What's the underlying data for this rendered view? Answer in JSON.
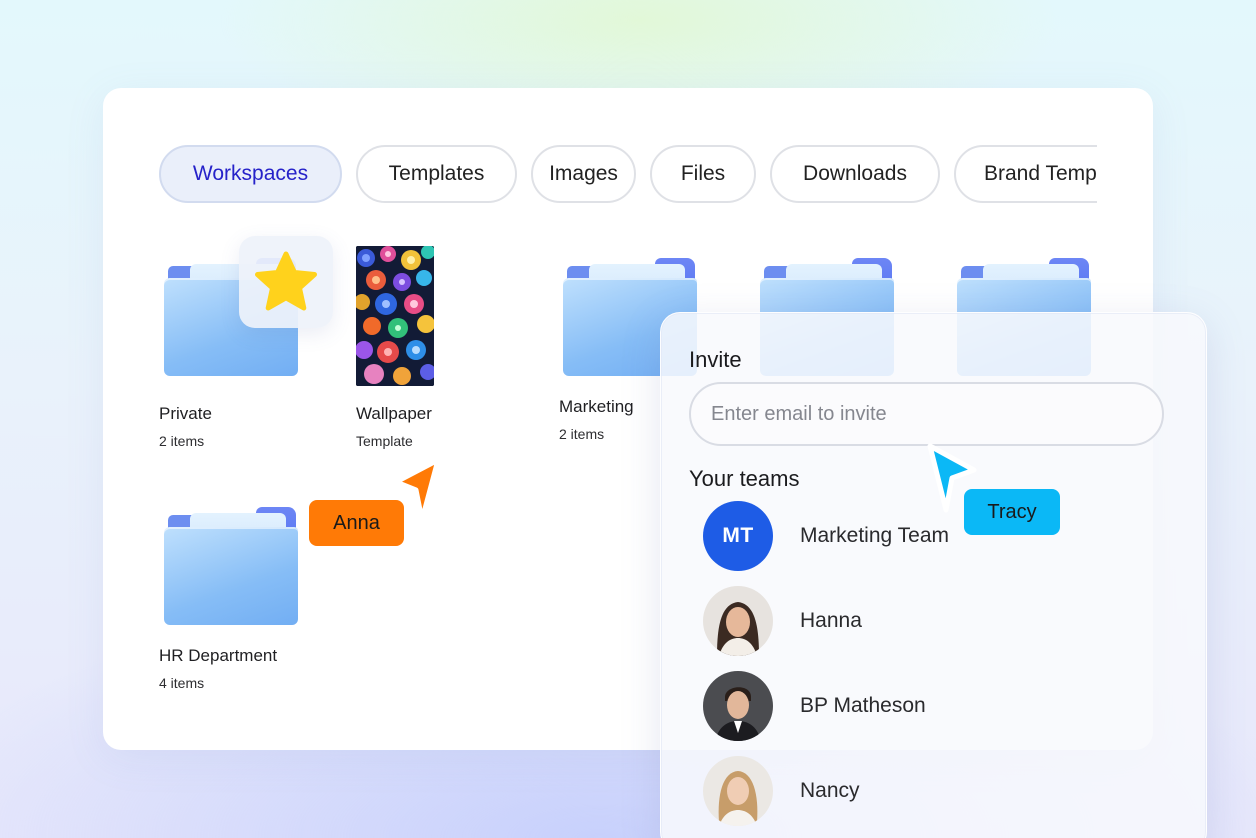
{
  "tabs": [
    {
      "label": "Workspaces",
      "active": true
    },
    {
      "label": "Templates",
      "active": false
    },
    {
      "label": "Images",
      "active": false
    },
    {
      "label": "Files",
      "active": false
    },
    {
      "label": "Downloads",
      "active": false
    },
    {
      "label": "Brand Templates",
      "active": false
    }
  ],
  "items": {
    "private": {
      "name": "Private",
      "meta": "2 items",
      "icon": "folder-icon",
      "badge_icon": "star-icon"
    },
    "wallpaper": {
      "name": "Wallpaper",
      "meta": "Template"
    },
    "marketing": {
      "name": "Marketing",
      "meta": "2 items",
      "icon": "folder-icon"
    },
    "hr": {
      "name": "HR Department",
      "meta": "4 items",
      "icon": "folder-icon"
    }
  },
  "invite": {
    "title": "Invite",
    "placeholder": "Enter email to invite",
    "teams_title": "Your teams",
    "members": [
      {
        "name": "Marketing Team",
        "initials": "MT"
      },
      {
        "name": "Hanna"
      },
      {
        "name": "BP Matheson"
      },
      {
        "name": "Nancy"
      }
    ]
  },
  "cursors": {
    "anna": {
      "label": "Anna",
      "color": "#ff7a06"
    },
    "tracy": {
      "label": "Tracy",
      "color": "#0bb8f6"
    }
  },
  "colors": {
    "accent_text": "#2622c9",
    "active_tab_bg": "#eaeffa",
    "avatar_blue": "#1e5ce6"
  }
}
